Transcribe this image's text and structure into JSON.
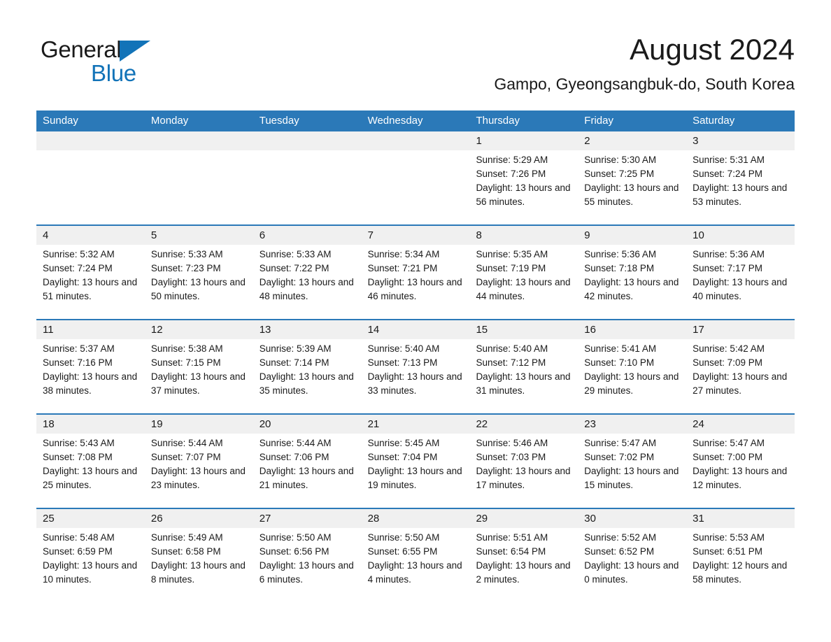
{
  "brand": {
    "name_part1": "General",
    "name_part2": "Blue",
    "color_primary": "#1273b8"
  },
  "header": {
    "month_title": "August 2024",
    "location": "Gampo, Gyeongsangbuk-do, South Korea"
  },
  "calendar": {
    "header_color": "#2b79b8",
    "weekdays": [
      "Sunday",
      "Monday",
      "Tuesday",
      "Wednesday",
      "Thursday",
      "Friday",
      "Saturday"
    ],
    "labels": {
      "sunrise": "Sunrise:",
      "sunset": "Sunset:",
      "daylight": "Daylight:"
    },
    "weeks": [
      [
        {
          "day": "",
          "empty": true
        },
        {
          "day": "",
          "empty": true
        },
        {
          "day": "",
          "empty": true
        },
        {
          "day": "",
          "empty": true
        },
        {
          "day": "1",
          "sunrise": "Sunrise: 5:29 AM",
          "sunset": "Sunset: 7:26 PM",
          "daylight": "Daylight: 13 hours and 56 minutes."
        },
        {
          "day": "2",
          "sunrise": "Sunrise: 5:30 AM",
          "sunset": "Sunset: 7:25 PM",
          "daylight": "Daylight: 13 hours and 55 minutes."
        },
        {
          "day": "3",
          "sunrise": "Sunrise: 5:31 AM",
          "sunset": "Sunset: 7:24 PM",
          "daylight": "Daylight: 13 hours and 53 minutes."
        }
      ],
      [
        {
          "day": "4",
          "sunrise": "Sunrise: 5:32 AM",
          "sunset": "Sunset: 7:24 PM",
          "daylight": "Daylight: 13 hours and 51 minutes."
        },
        {
          "day": "5",
          "sunrise": "Sunrise: 5:33 AM",
          "sunset": "Sunset: 7:23 PM",
          "daylight": "Daylight: 13 hours and 50 minutes."
        },
        {
          "day": "6",
          "sunrise": "Sunrise: 5:33 AM",
          "sunset": "Sunset: 7:22 PM",
          "daylight": "Daylight: 13 hours and 48 minutes."
        },
        {
          "day": "7",
          "sunrise": "Sunrise: 5:34 AM",
          "sunset": "Sunset: 7:21 PM",
          "daylight": "Daylight: 13 hours and 46 minutes."
        },
        {
          "day": "8",
          "sunrise": "Sunrise: 5:35 AM",
          "sunset": "Sunset: 7:19 PM",
          "daylight": "Daylight: 13 hours and 44 minutes."
        },
        {
          "day": "9",
          "sunrise": "Sunrise: 5:36 AM",
          "sunset": "Sunset: 7:18 PM",
          "daylight": "Daylight: 13 hours and 42 minutes."
        },
        {
          "day": "10",
          "sunrise": "Sunrise: 5:36 AM",
          "sunset": "Sunset: 7:17 PM",
          "daylight": "Daylight: 13 hours and 40 minutes."
        }
      ],
      [
        {
          "day": "11",
          "sunrise": "Sunrise: 5:37 AM",
          "sunset": "Sunset: 7:16 PM",
          "daylight": "Daylight: 13 hours and 38 minutes."
        },
        {
          "day": "12",
          "sunrise": "Sunrise: 5:38 AM",
          "sunset": "Sunset: 7:15 PM",
          "daylight": "Daylight: 13 hours and 37 minutes."
        },
        {
          "day": "13",
          "sunrise": "Sunrise: 5:39 AM",
          "sunset": "Sunset: 7:14 PM",
          "daylight": "Daylight: 13 hours and 35 minutes."
        },
        {
          "day": "14",
          "sunrise": "Sunrise: 5:40 AM",
          "sunset": "Sunset: 7:13 PM",
          "daylight": "Daylight: 13 hours and 33 minutes."
        },
        {
          "day": "15",
          "sunrise": "Sunrise: 5:40 AM",
          "sunset": "Sunset: 7:12 PM",
          "daylight": "Daylight: 13 hours and 31 minutes."
        },
        {
          "day": "16",
          "sunrise": "Sunrise: 5:41 AM",
          "sunset": "Sunset: 7:10 PM",
          "daylight": "Daylight: 13 hours and 29 minutes."
        },
        {
          "day": "17",
          "sunrise": "Sunrise: 5:42 AM",
          "sunset": "Sunset: 7:09 PM",
          "daylight": "Daylight: 13 hours and 27 minutes."
        }
      ],
      [
        {
          "day": "18",
          "sunrise": "Sunrise: 5:43 AM",
          "sunset": "Sunset: 7:08 PM",
          "daylight": "Daylight: 13 hours and 25 minutes."
        },
        {
          "day": "19",
          "sunrise": "Sunrise: 5:44 AM",
          "sunset": "Sunset: 7:07 PM",
          "daylight": "Daylight: 13 hours and 23 minutes."
        },
        {
          "day": "20",
          "sunrise": "Sunrise: 5:44 AM",
          "sunset": "Sunset: 7:06 PM",
          "daylight": "Daylight: 13 hours and 21 minutes."
        },
        {
          "day": "21",
          "sunrise": "Sunrise: 5:45 AM",
          "sunset": "Sunset: 7:04 PM",
          "daylight": "Daylight: 13 hours and 19 minutes."
        },
        {
          "day": "22",
          "sunrise": "Sunrise: 5:46 AM",
          "sunset": "Sunset: 7:03 PM",
          "daylight": "Daylight: 13 hours and 17 minutes."
        },
        {
          "day": "23",
          "sunrise": "Sunrise: 5:47 AM",
          "sunset": "Sunset: 7:02 PM",
          "daylight": "Daylight: 13 hours and 15 minutes."
        },
        {
          "day": "24",
          "sunrise": "Sunrise: 5:47 AM",
          "sunset": "Sunset: 7:00 PM",
          "daylight": "Daylight: 13 hours and 12 minutes."
        }
      ],
      [
        {
          "day": "25",
          "sunrise": "Sunrise: 5:48 AM",
          "sunset": "Sunset: 6:59 PM",
          "daylight": "Daylight: 13 hours and 10 minutes."
        },
        {
          "day": "26",
          "sunrise": "Sunrise: 5:49 AM",
          "sunset": "Sunset: 6:58 PM",
          "daylight": "Daylight: 13 hours and 8 minutes."
        },
        {
          "day": "27",
          "sunrise": "Sunrise: 5:50 AM",
          "sunset": "Sunset: 6:56 PM",
          "daylight": "Daylight: 13 hours and 6 minutes."
        },
        {
          "day": "28",
          "sunrise": "Sunrise: 5:50 AM",
          "sunset": "Sunset: 6:55 PM",
          "daylight": "Daylight: 13 hours and 4 minutes."
        },
        {
          "day": "29",
          "sunrise": "Sunrise: 5:51 AM",
          "sunset": "Sunset: 6:54 PM",
          "daylight": "Daylight: 13 hours and 2 minutes."
        },
        {
          "day": "30",
          "sunrise": "Sunrise: 5:52 AM",
          "sunset": "Sunset: 6:52 PM",
          "daylight": "Daylight: 13 hours and 0 minutes."
        },
        {
          "day": "31",
          "sunrise": "Sunrise: 5:53 AM",
          "sunset": "Sunset: 6:51 PM",
          "daylight": "Daylight: 12 hours and 58 minutes."
        }
      ]
    ]
  }
}
